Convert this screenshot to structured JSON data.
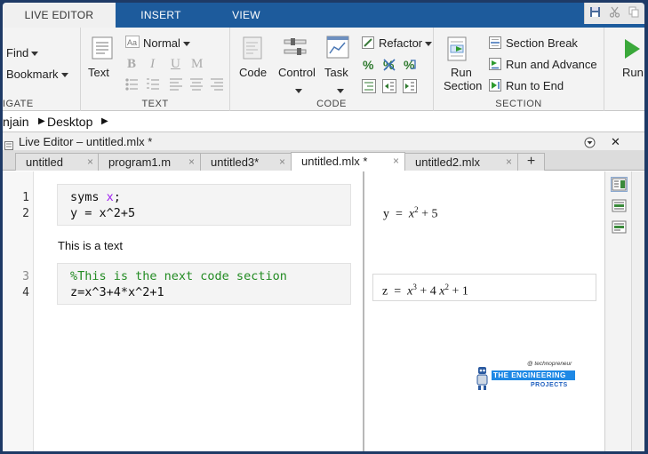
{
  "ribbon_tabs": [
    {
      "label": "LIVE EDITOR",
      "active": true
    },
    {
      "label": "INSERT",
      "active": false
    },
    {
      "label": "VIEW",
      "active": false
    }
  ],
  "navigate": {
    "find_label": "Find",
    "bookmark_label": "Bookmark",
    "section_label": "IGATE"
  },
  "text_section": {
    "text_button": "Text",
    "style_value": "Normal",
    "bold": "B",
    "italic": "I",
    "underline": "U",
    "mono": "M",
    "section_label": "TEXT"
  },
  "code_section": {
    "code_button": "Code",
    "control_button": "Control",
    "task_button": "Task",
    "refactor_button": "Refactor",
    "section_label": "CODE"
  },
  "section_section": {
    "run_section_line1": "Run",
    "run_section_line2": "Section",
    "section_break": "Section Break",
    "run_and_advance": "Run and Advance",
    "run_to_end": "Run to End",
    "section_label": "SECTION"
  },
  "run_button": "Run",
  "address": {
    "user": "njain",
    "folder": "Desktop"
  },
  "editor": {
    "window_title": "Live Editor – untitled.mlx *",
    "file_tabs": [
      {
        "label": "untitled",
        "active": false
      },
      {
        "label": "program1.m",
        "active": false
      },
      {
        "label": "untitled3*",
        "active": false
      },
      {
        "label": "untitled.mlx *",
        "active": true
      },
      {
        "label": "untitled2.mlx",
        "active": false
      }
    ],
    "add_tab": "+",
    "close_tab": "×"
  },
  "code": {
    "line_numbers": [
      "1",
      "2",
      "3",
      "4"
    ],
    "block1": {
      "line1_prefix": "syms ",
      "line1_var": "x",
      "line1_suffix": ";",
      "line2": "y = x^2+5"
    },
    "text_line": "This is a text",
    "block2": {
      "line1_comment": "%This is the next code section",
      "line2": "z=x^3+4*x^2+1"
    }
  },
  "output": {
    "y_lhs": "y",
    "y_eq": "=",
    "y_x": "x",
    "y_exp": "2",
    "y_rest": "+ 5",
    "z_lhs": "z",
    "z_eq": "=",
    "z_x1": "x",
    "z_exp1": "3",
    "z_mid": "+ 4",
    "z_x2": "x",
    "z_exp2": "2",
    "z_rest": "+ 1"
  },
  "watermark": {
    "tagline": "@ technopreneur",
    "line1": "THE ENGINEERING",
    "line2": "PROJECTS"
  },
  "colors": {
    "tab_strip": "#1d5b9c",
    "frame_border": "#1e3a66",
    "comment": "#228b22",
    "keyword_var": "#a020f0"
  }
}
